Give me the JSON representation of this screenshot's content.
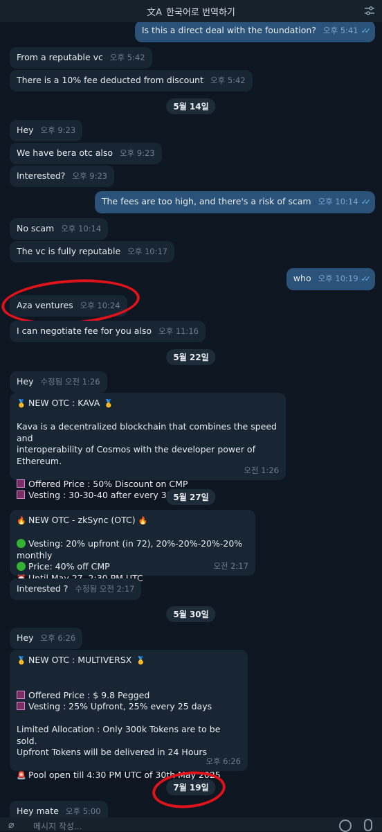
{
  "header": {
    "translate_label": "한국어로 번역하기",
    "translate_icon": "translate-icon",
    "filter_icon": "filter-icon"
  },
  "messages": {
    "m1": {
      "text": "Is this a direct deal with the foundation?",
      "time": "오후 5:41"
    },
    "m2": {
      "text": "From a reputable vc",
      "time": "오후 5:42"
    },
    "m3": {
      "text": "There is a 10% fee deducted from discount",
      "time": "오후 5:42"
    },
    "d1": "5월 14일",
    "m4": {
      "text": "Hey",
      "time": "오후 9:23"
    },
    "m5": {
      "text": "We have bera otc also",
      "time": "오후 9:23"
    },
    "m6": {
      "text": "Interested?",
      "time": "오후 9:23"
    },
    "m7": {
      "text": "The fees are too high, and there's a risk of scam",
      "time": "오후 10:14"
    },
    "m8": {
      "text": "No scam",
      "time": "오후 10:14"
    },
    "m9": {
      "text": "The vc is fully reputable",
      "time": "오후 10:17"
    },
    "m10": {
      "text": "who",
      "time": "오후 10:19"
    },
    "m11": {
      "text": "Aza ventures",
      "time": "오후 10:24"
    },
    "m12": {
      "text": "I can negotiate fee for you also",
      "time": "오후 11:16"
    },
    "d2": "5월 22일",
    "m13": {
      "text": "Hey",
      "time": "수정됨 오전 1:26"
    },
    "m14": {
      "title": "NEW OTC : KAVA",
      "desc1": "Kava is a decentralized blockchain that combines the speed and",
      "desc2": "interoperability of Cosmos with the developer power of Ethereum.",
      "price": "Offered Price : 50% Discount on CMP",
      "vesting": "Vesting : 30-30-40 after every 31 days",
      "time": "오전 1:26"
    },
    "d3": "5월 27일",
    "m15": {
      "title": "NEW OTC - zkSync (OTC)",
      "vesting": "Vesting: 20% upfront (in 72), 20%-20%-20%-20% monthly",
      "price": "Price: 40% off CMP",
      "until": "Until May 27, 2:30 PM UTC",
      "time": "오전 2:17"
    },
    "m16": {
      "text": "Interested ?",
      "time": "수정됨 오전 2:17"
    },
    "d4": "5월 30일",
    "m17": {
      "text": "Hey",
      "time": "오후 6:26"
    },
    "m18": {
      "title": "NEW OTC : MULTIVERSX",
      "price": "Offered Price : $ 9.8 Pegged",
      "vesting": "Vesting : 25% Upfront, 25% every 25 days",
      "alloc1": "Limited Allocation : Only 300k Tokens are to be sold.",
      "alloc2": "Upfront Tokens will be delivered in 24 Hours",
      "pool": "Pool open till 4:30 PM UTC of 30th May 2025",
      "time": "오후 6:26"
    },
    "d5": "7월 19일",
    "m19": {
      "text": "Hey mate",
      "time": "오후 5:00"
    }
  },
  "composer": {
    "placeholder": "메시지 작성...",
    "attach_icon": "paperclip-icon",
    "emoji_icon": "emoji-icon",
    "mic_icon": "microphone-icon"
  },
  "colors": {
    "background": "#0e1621",
    "incoming": "#182533",
    "outgoing": "#2b5278",
    "annotation": "#e0131b"
  }
}
